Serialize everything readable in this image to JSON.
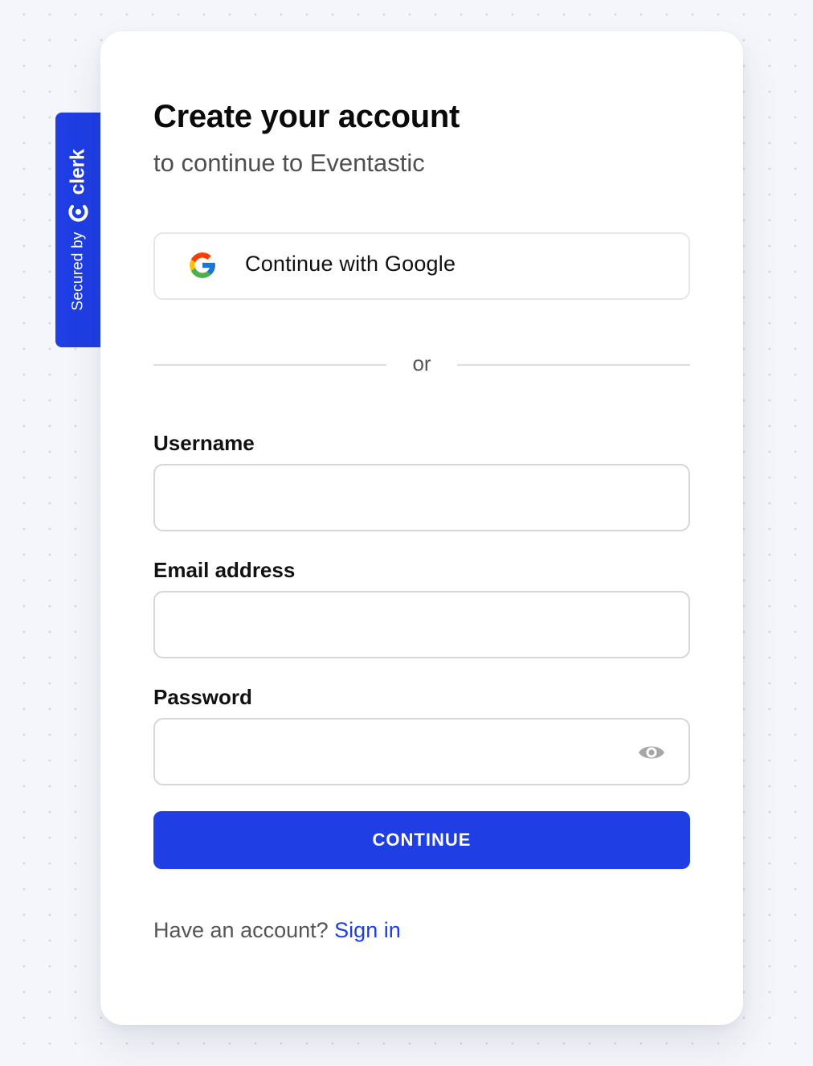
{
  "badge": {
    "prefix": "Secured by",
    "brand": "clerk",
    "icon": "clerk-logo-icon"
  },
  "header": {
    "title": "Create your account",
    "subtitle": "to continue to Eventastic"
  },
  "social": {
    "google_label": "Continue with Google",
    "icon": "google-icon"
  },
  "divider": {
    "text": "or"
  },
  "form": {
    "username": {
      "label": "Username",
      "value": ""
    },
    "email": {
      "label": "Email address",
      "value": ""
    },
    "password": {
      "label": "Password",
      "value": "",
      "toggle_icon": "eye-icon"
    },
    "submit_label": "CONTINUE"
  },
  "footer": {
    "prompt": "Have an account?",
    "link_label": "Sign in"
  },
  "colors": {
    "accent": "#1f3ee3",
    "background": "#f5f6fb",
    "card": "#ffffff"
  }
}
